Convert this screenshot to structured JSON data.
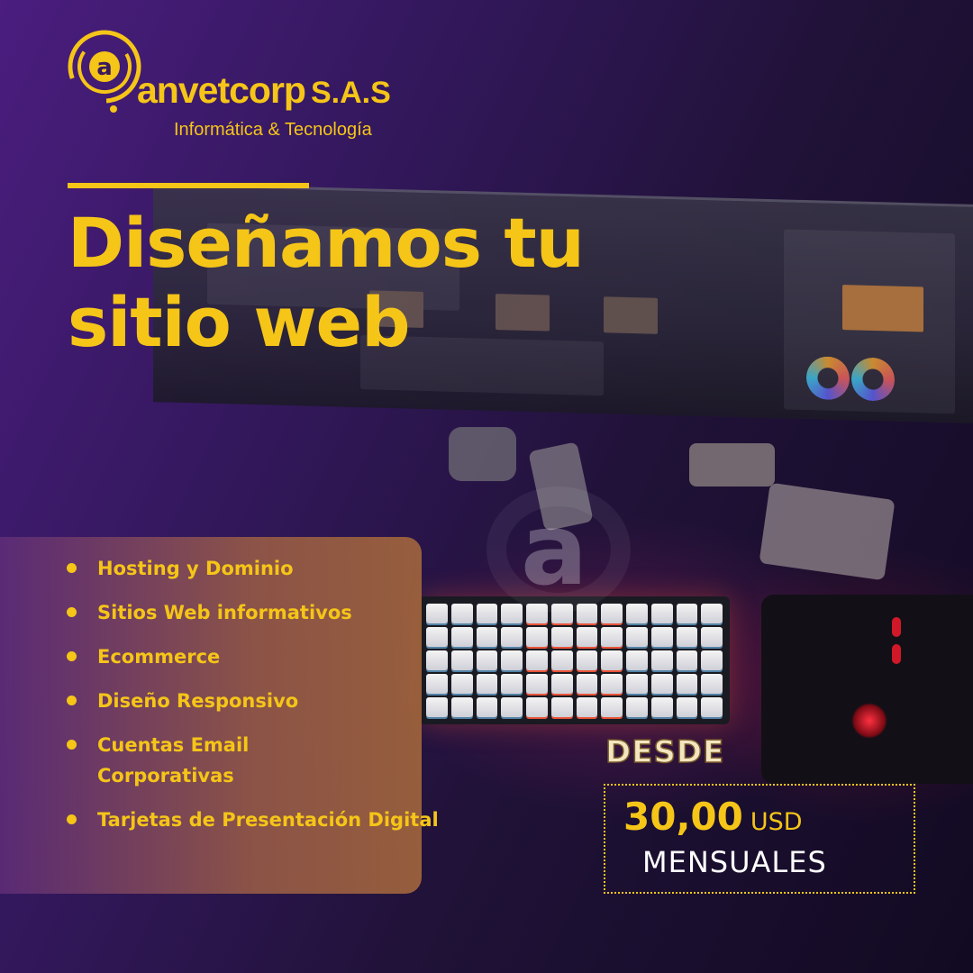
{
  "brand": {
    "logo_letter": "a",
    "name": "anvetcorp",
    "suffix": "S.A.S",
    "tagline": "Informática & Tecnología"
  },
  "headline": {
    "line1": "Diseñamos tu",
    "line2": "sitio web"
  },
  "services": [
    "Hosting y Dominio",
    "Sitios Web informativos",
    "Ecommerce",
    "Diseño Responsivo",
    "Cuentas Email Corporativas",
    "Tarjetas de Presentación Digital"
  ],
  "pricing": {
    "prefix": "DESDE",
    "amount": "30,00",
    "currency": "USD",
    "period": "MENSUALES"
  },
  "watermark_letter": "a",
  "colors": {
    "accent": "#f5c518",
    "background": "#2a1450",
    "panel": "#9a6048"
  }
}
